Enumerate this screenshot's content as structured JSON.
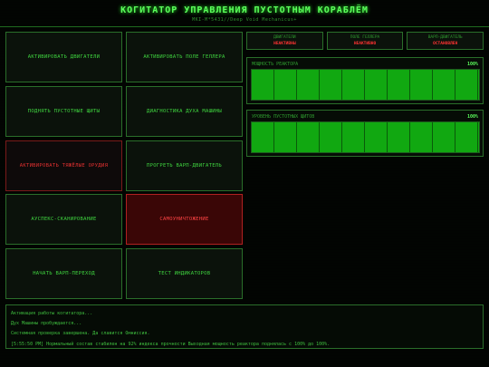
{
  "header": {
    "title": "КОГИТАТОР УПРАВЛЕНИЯ ПУСТОТНЫМ КОРАБЛЁМ",
    "subtitle": "MKI-M*5431//Deep Void Mechanicus+"
  },
  "buttons": [
    {
      "label": "АКТИВИРОВАТЬ ДВИГАТЕЛИ",
      "state": "normal"
    },
    {
      "label": "АКТИВИРОВАТЬ ПОЛЕ ГЕЛЛЕРА",
      "state": "normal"
    },
    {
      "label": "ПОДНЯТЬ ПУСТОТНЫЕ ЩИТЫ",
      "state": "normal"
    },
    {
      "label": "ДИАГНОСТИКА ДУХА МАШИНЫ",
      "state": "normal"
    },
    {
      "label": "АКТИВИРОВАТЬ ТЯЖЁЛЫЕ ОРУДИЯ",
      "state": "warn"
    },
    {
      "label": "ПРОГРЕТЬ ВАРП-ДВИГАТЕЛЬ",
      "state": "normal"
    },
    {
      "label": "АУСПЕКС-СКАНИРОВАНИЕ",
      "state": "normal"
    },
    {
      "label": "САМОУНИЧТОЖЕНИЕ",
      "state": "alarm"
    },
    {
      "label": "НАЧАТЬ ВАРП-ПЕРЕХОД",
      "state": "normal"
    },
    {
      "label": "ТЕСТ ИНДИКАТОРОВ",
      "state": "normal"
    }
  ],
  "status": [
    {
      "label": "ДВИГАТЕЛИ",
      "value": "НЕАКТИВНЫ"
    },
    {
      "label": "ПОЛЕ ГЕЛЛЕРА",
      "value": "НЕАКТИВНО"
    },
    {
      "label": "ВАРП-ДВИГАТЕЛЬ",
      "value": "ОСТАНОВЛЕН"
    }
  ],
  "meters": [
    {
      "label": "МОЩНОСТЬ РЕАКТОРА",
      "percent_text": "100%",
      "fraction": 1.0
    },
    {
      "label": "УРОВЕНЬ ПУСТОТНЫХ ЩИТОВ",
      "percent_text": "100%",
      "fraction": 1.0
    }
  ],
  "log": [
    "Активация работы когитатора...",
    "Дух Машины пробуждается...",
    "Системная проверка завершена. Да славится Омниссия.",
    "[5:55:50 PM] Нормальный состав стабилен на 92% индекса прочности Выходная мощность реактора поднялась с 100% до 100%."
  ],
  "colors": {
    "accent": "#33cc33",
    "alert": "#ff3333",
    "alarm_bg": "#3a0606"
  }
}
